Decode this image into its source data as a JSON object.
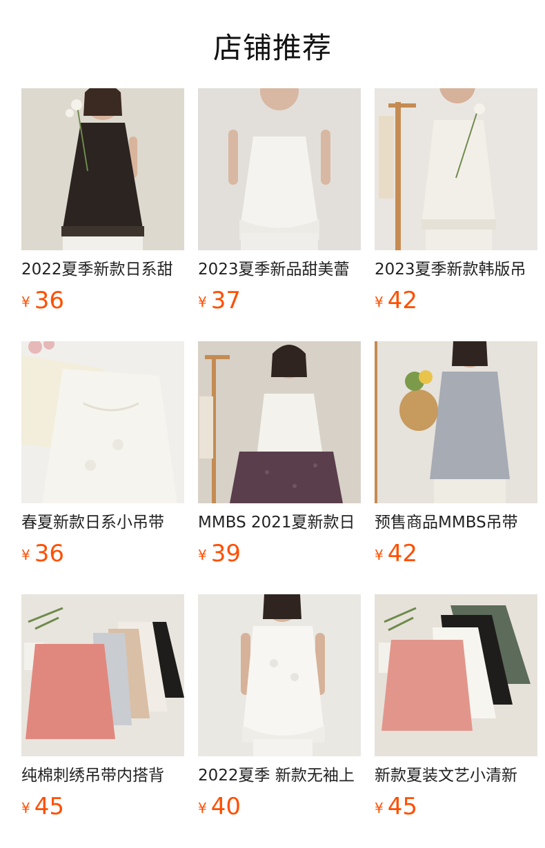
{
  "title": "店铺推荐",
  "currency": "¥",
  "products": [
    {
      "name": "2022夏季新款日系甜",
      "price": "36",
      "bg": "#ddd9cf",
      "garment": "#2b2420"
    },
    {
      "name": "2023夏季新品甜美蕾",
      "price": "37",
      "bg": "#e2dfda",
      "garment": "#f5f3ef"
    },
    {
      "name": "2023夏季新款韩版吊",
      "price": "42",
      "bg": "#e9e6e1",
      "garment": "#f2efe8"
    },
    {
      "name": "春夏新款日系小吊带",
      "price": "36",
      "bg": "#f0efec",
      "garment": "#f6f4ee"
    },
    {
      "name": "MMBS 2021夏新款日",
      "price": "39",
      "bg": "#d7d1c8",
      "garment": "#f4f2ec"
    },
    {
      "name": "预售商品MMBS吊带",
      "price": "42",
      "bg": "#e6e2dc",
      "garment": "#a6abb4"
    },
    {
      "name": "纯棉刺绣吊带内搭背",
      "price": "45",
      "bg": "#e8e5de",
      "garment": "#e1887e"
    },
    {
      "name": "2022夏季 新款无袖上",
      "price": "40",
      "bg": "#eae8e3",
      "garment": "#f7f6f2"
    },
    {
      "name": "新款夏装文艺小清新",
      "price": "45",
      "bg": "#e6e2da",
      "garment": "#e2968b"
    }
  ]
}
